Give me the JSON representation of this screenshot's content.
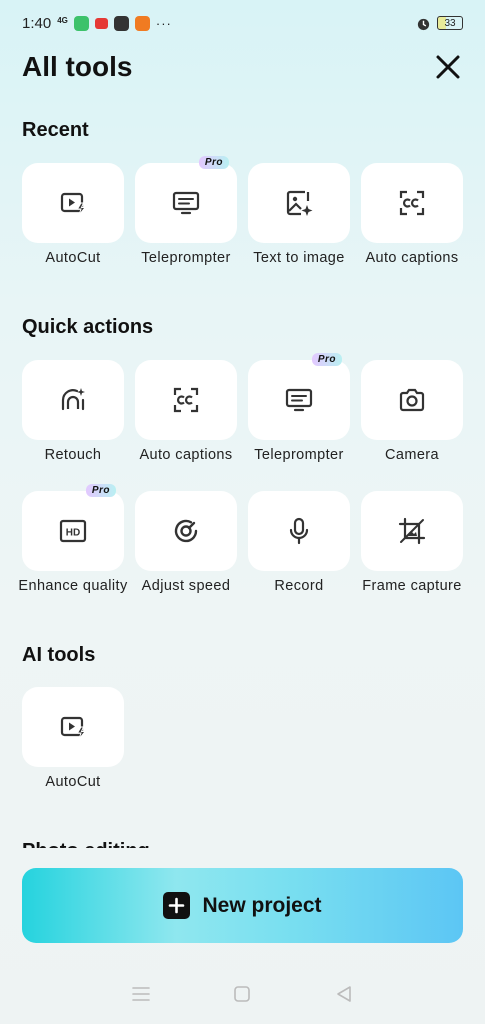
{
  "status_bar": {
    "time": "1:40",
    "network": "4G",
    "dots": "···",
    "battery": "33"
  },
  "header": {
    "title": "All tools"
  },
  "sections": {
    "recent": {
      "title": "Recent",
      "items": [
        {
          "label": "AutoCut",
          "icon": "autocut-icon"
        },
        {
          "label": "Teleprompter",
          "icon": "teleprompter-icon",
          "badge": "Pro"
        },
        {
          "label": "Text to image",
          "icon": "text-to-image-icon"
        },
        {
          "label": "Auto captions",
          "icon": "captions-icon"
        }
      ]
    },
    "quick_actions": {
      "title": "Quick actions",
      "items": [
        {
          "label": "Retouch",
          "icon": "retouch-icon"
        },
        {
          "label": "Auto captions",
          "icon": "captions-icon"
        },
        {
          "label": "Teleprompter",
          "icon": "teleprompter-icon",
          "badge": "Pro"
        },
        {
          "label": "Camera",
          "icon": "camera-icon"
        },
        {
          "label": "Enhance quality",
          "icon": "hd-icon",
          "badge": "Pro"
        },
        {
          "label": "Adjust speed",
          "icon": "speed-icon"
        },
        {
          "label": "Record",
          "icon": "microphone-icon"
        },
        {
          "label": "Frame capture",
          "icon": "frame-capture-icon"
        }
      ]
    },
    "ai_tools": {
      "title": "AI tools",
      "items": [
        {
          "label": "AutoCut",
          "icon": "autocut-icon"
        }
      ]
    },
    "photo_editing": {
      "title": "Photo editing"
    }
  },
  "new_project": {
    "label": "New project"
  },
  "colors": {
    "accent_start": "#25d3de",
    "accent_end": "#5cc6f4",
    "card": "#ffffff"
  }
}
